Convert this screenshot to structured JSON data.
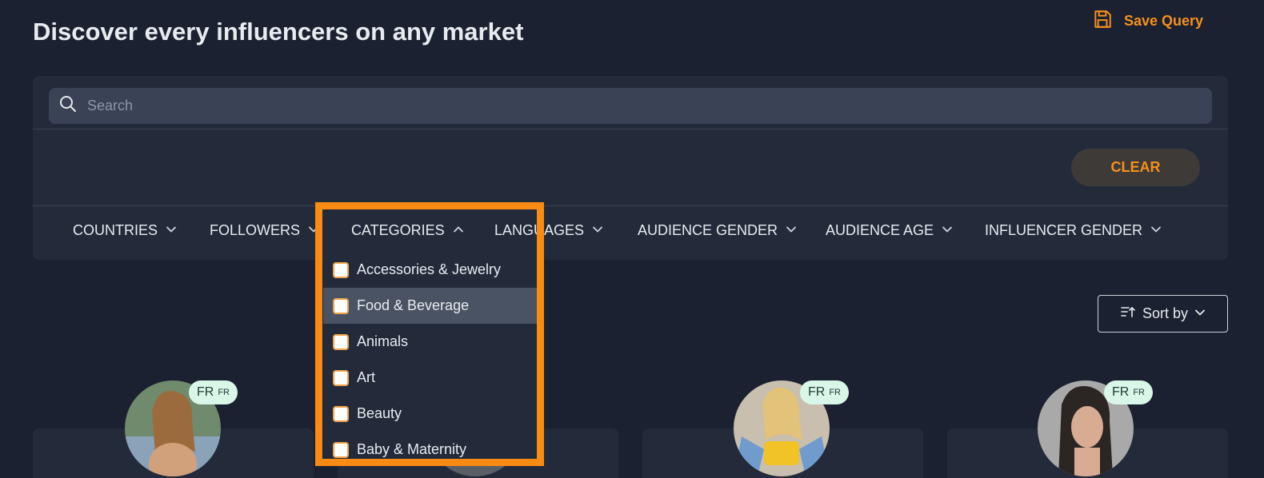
{
  "header": {
    "title": "Discover every influencers on any market",
    "save_query_label": "Save Query",
    "accent_color": "#f7901e"
  },
  "search": {
    "placeholder": "Search"
  },
  "clear_label": "CLEAR",
  "filters": [
    {
      "label": "COUNTRIES",
      "icon": "chevron-down-icon"
    },
    {
      "label": "FOLLOWERS",
      "icon": "chevron-down-icon"
    },
    {
      "label": "CATEGORIES",
      "icon": "chevron-up-icon"
    },
    {
      "label": "LANGUAGES",
      "icon": "chevron-down-icon"
    },
    {
      "label": "AUDIENCE GENDER",
      "icon": "chevron-down-icon"
    },
    {
      "label": "AUDIENCE AGE",
      "icon": "chevron-down-icon"
    },
    {
      "label": "INFLUENCER GENDER",
      "icon": "chevron-down-icon"
    }
  ],
  "categories_dropdown": {
    "items": [
      {
        "label": "Accessories & Jewelry",
        "checked": false
      },
      {
        "label": "Food & Beverage",
        "checked": false,
        "hovered": true
      },
      {
        "label": "Animals",
        "checked": false
      },
      {
        "label": "Art",
        "checked": false
      },
      {
        "label": "Beauty",
        "checked": false
      },
      {
        "label": "Baby & Maternity",
        "checked": false
      }
    ]
  },
  "sort": {
    "label": "Sort by"
  },
  "cards": [
    {
      "country": "FR",
      "country_sub": "FR"
    },
    {
      "country": "",
      "country_sub": ""
    },
    {
      "country": "FR",
      "country_sub": "FR"
    },
    {
      "country": "FR",
      "country_sub": "FR"
    }
  ]
}
